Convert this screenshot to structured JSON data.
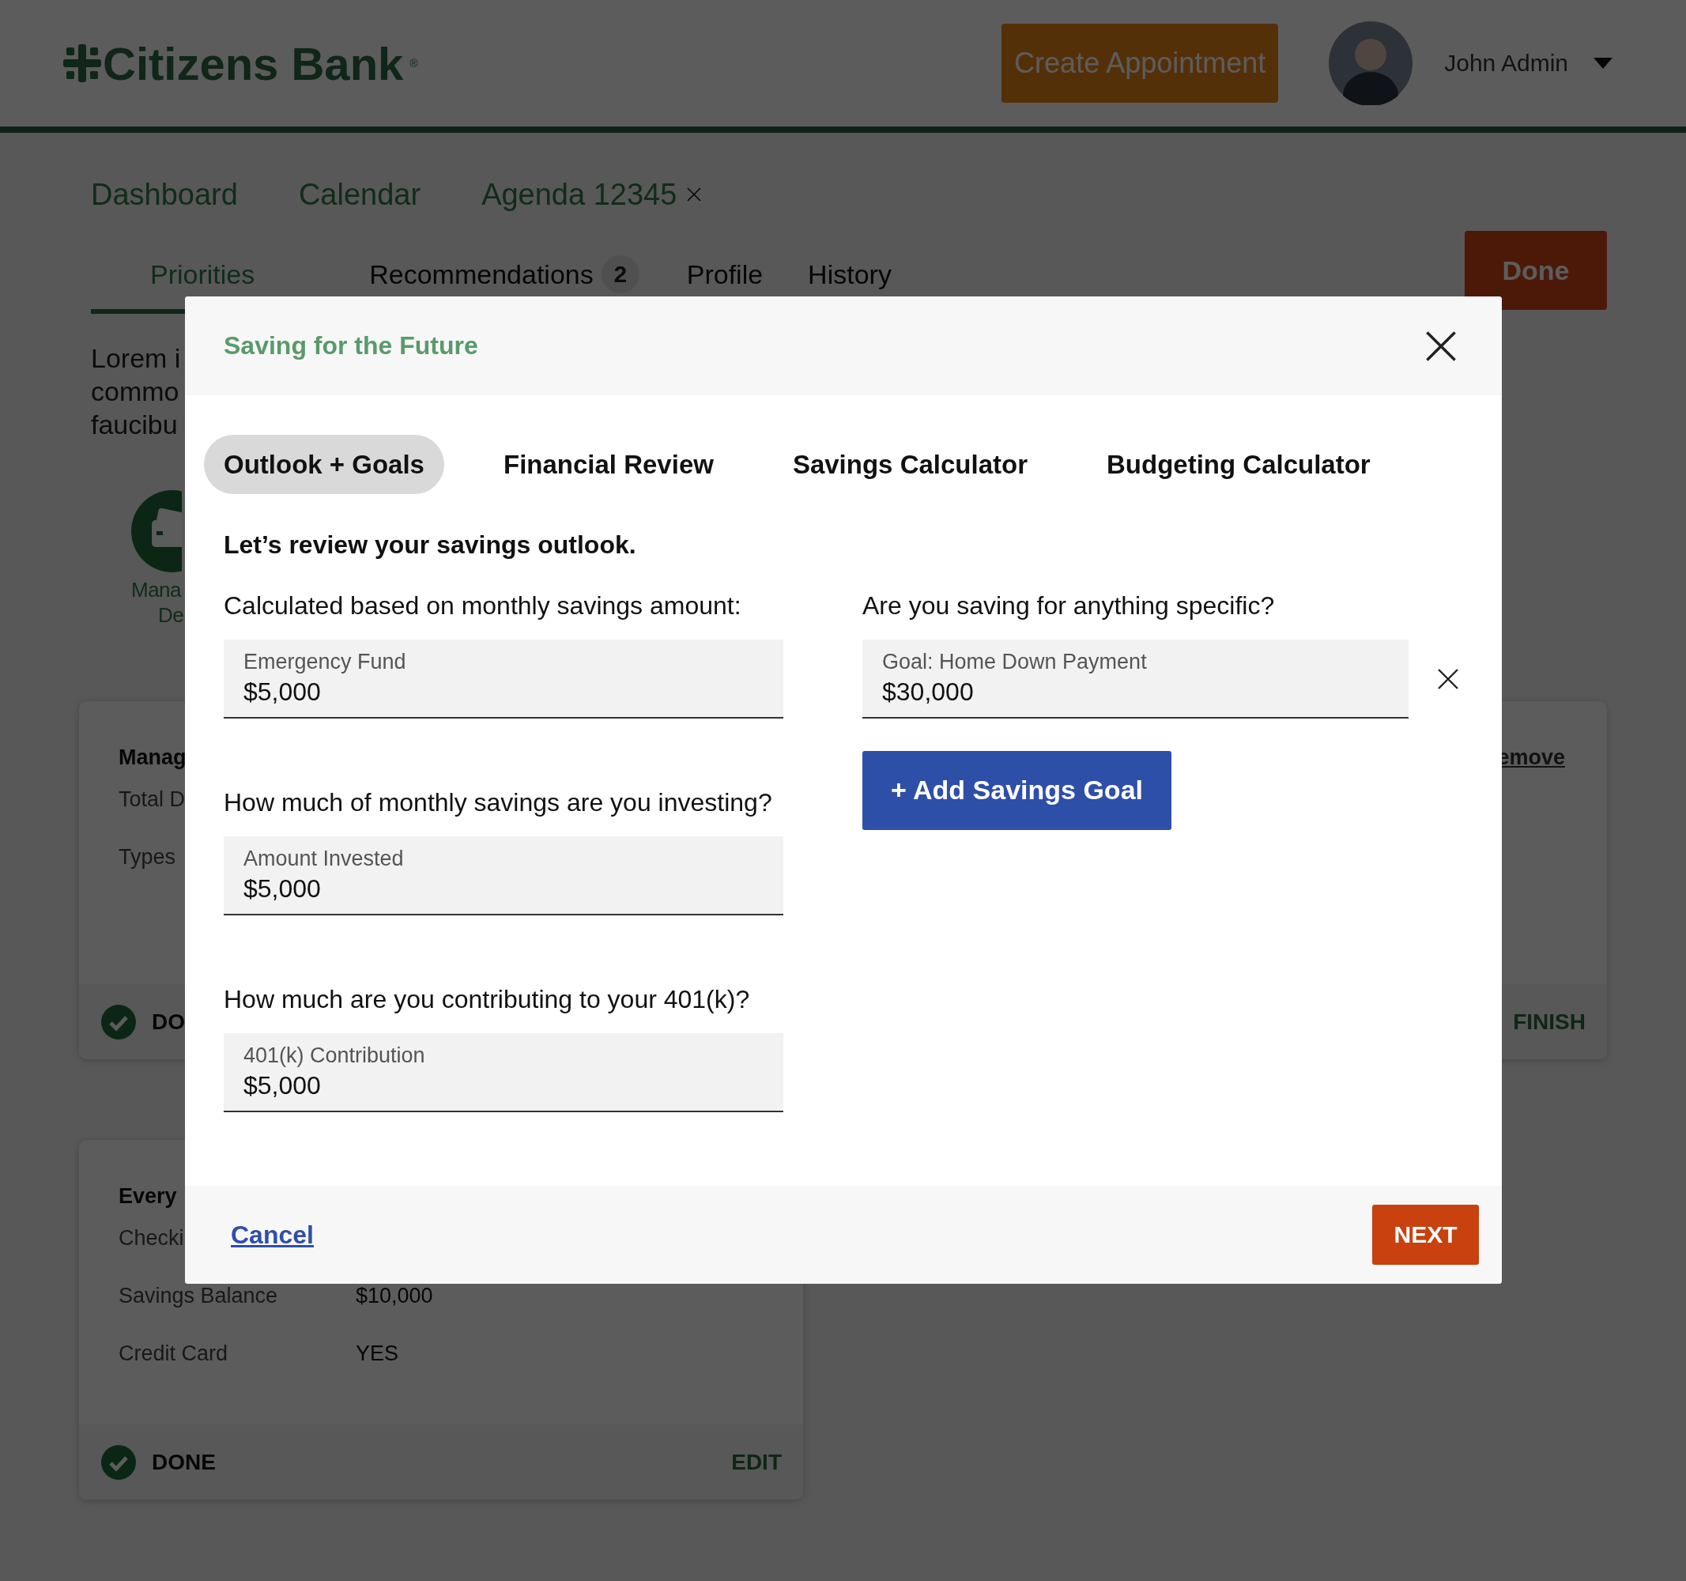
{
  "header": {
    "logo": "Citizens Bank$^{®}$",
    "create_button": "Create Appointment",
    "user": "John Admin"
  },
  "nav_tabs": [
    {
      "label": "Dashboard",
      "closable": false
    },
    {
      "label": "Calendar",
      "closable": false
    },
    {
      "label": "Agenda 12345",
      "closable": true
    }
  ],
  "sub_tabs": [
    {
      "label": "Priorities",
      "selected": true
    },
    {
      "label": "Recommendations",
      "badge": "2",
      "selected": false
    },
    {
      "label": "Profile",
      "selected": false
    },
    {
      "label": "History",
      "selected": false
    }
  ],
  "done_button": "Done",
  "intro_lines": [
    "Lorem i",
    "commo",
    "faucibu"
  ],
  "feature": {
    "label_lines": [
      "Mana",
      "De"
    ]
  },
  "cards": [
    {
      "title": "Manag",
      "remove_link": "emove",
      "rows": [
        {
          "label": "Total D"
        },
        {
          "label": "Types"
        }
      ],
      "status": "DO",
      "done": true,
      "action": "FINISH"
    },
    {
      "title": "Every",
      "rows": [
        {
          "label": "Checki"
        },
        {
          "label": "Savings Balance",
          "value": "$10,000"
        },
        {
          "label": "Credit Card",
          "value": "YES"
        }
      ],
      "status": "DONE",
      "done": true,
      "action": "EDIT"
    }
  ],
  "modal": {
    "title": "Saving for the Future",
    "tabs": [
      {
        "label": "Outlook + Goals",
        "selected": true
      },
      {
        "label": "Financial Review",
        "selected": false
      },
      {
        "label": "Savings Calculator",
        "selected": false
      },
      {
        "label": "Budgeting Calculator",
        "selected": false
      }
    ],
    "heading": "Let’s review your savings outlook.",
    "left_fields": [
      {
        "question": "Calculated based on monthly savings amount:",
        "label": "Emergency Fund",
        "value": "$5,000"
      },
      {
        "question": "How much of monthly savings are you investing?",
        "label": "Amount Invested",
        "value": "$5,000"
      },
      {
        "question": "How much are you contributing to your 401(k)?",
        "label": "401(k) Contribution",
        "value": "$5,000"
      }
    ],
    "right": {
      "question": "Are you saving for anything specific?",
      "goals": [
        {
          "label": "Goal: Home Down Payment",
          "value": "$30,000"
        }
      ],
      "add_button": "+ Add Savings Goal"
    },
    "cancel_link": "Cancel",
    "next_button": "NEXT"
  }
}
